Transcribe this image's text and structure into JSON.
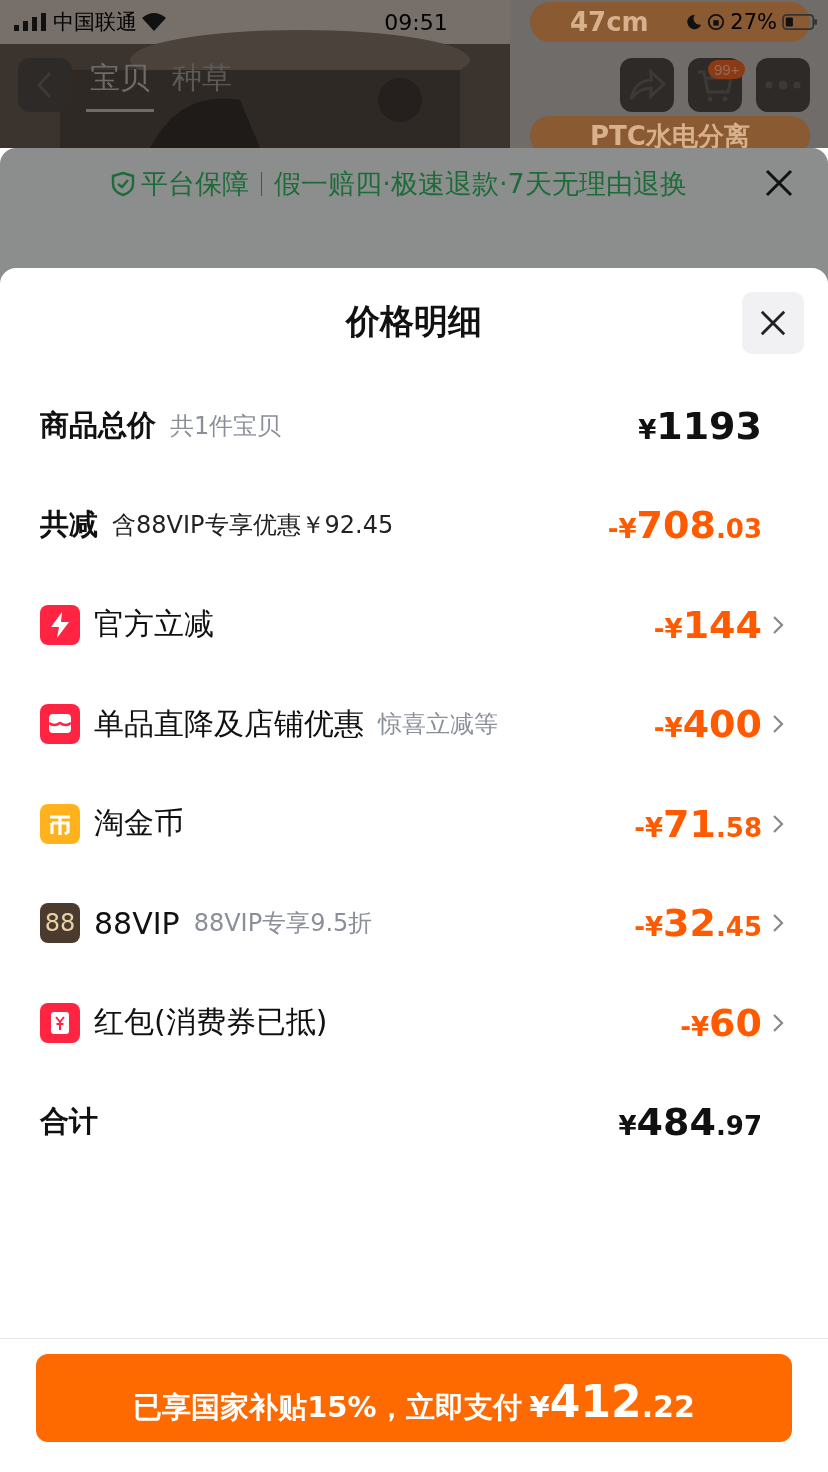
{
  "status_bar": {
    "carrier": "中国联通",
    "time": "09:51",
    "battery": "27%"
  },
  "nav": {
    "tabs": [
      {
        "label": "宝贝",
        "selected": true
      },
      {
        "label": "种草",
        "selected": false
      }
    ],
    "cart_badge": "99+"
  },
  "product_tags": [
    "47cm",
    "PTC水电分离"
  ],
  "guarantee": {
    "title": "平台保障",
    "text": "假一赔四·极速退款·7天无理由退换"
  },
  "sheet": {
    "title": "价格明细",
    "total": {
      "label": "商品总价",
      "note": "共1件宝贝",
      "amount": {
        "sign": "¥",
        "int": "1193"
      }
    },
    "discount": {
      "label": "共减",
      "note": "含88VIP专享优惠￥92.45",
      "amount": {
        "sign": "-¥",
        "int": "708",
        "dec": ".03"
      }
    },
    "items": [
      {
        "kind": "bolt",
        "label": "官方立减",
        "amount": {
          "sign": "-¥",
          "int": "144"
        }
      },
      {
        "kind": "store",
        "label": "单品直降及店铺优惠",
        "note": "惊喜立减等",
        "amount": {
          "sign": "-¥",
          "int": "400"
        }
      },
      {
        "kind": "coin",
        "label": "淘金币",
        "amount": {
          "sign": "-¥",
          "int": "71",
          "dec": ".58"
        }
      },
      {
        "kind": "vip",
        "badge": "88",
        "label": "88VIP",
        "note": "88VIP专享9.5折",
        "amount": {
          "sign": "-¥",
          "int": "32",
          "dec": ".45"
        }
      },
      {
        "kind": "redpacket",
        "label": "红包(消费券已抵)",
        "amount": {
          "sign": "-¥",
          "int": "60"
        }
      }
    ],
    "sum": {
      "label": "合计",
      "amount": {
        "sign": "¥",
        "int": "484",
        "dec": ".97"
      }
    },
    "pay_button": {
      "text": "已享国家补贴15%，立即支付",
      "sign": "¥",
      "int": "412",
      "dec": ".22"
    }
  }
}
